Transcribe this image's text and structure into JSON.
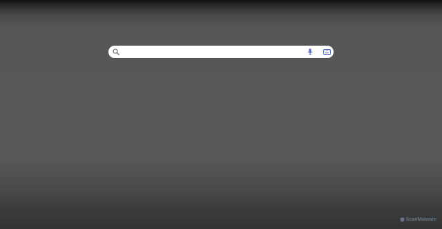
{
  "search": {
    "value": "",
    "placeholder": ""
  },
  "icons": {
    "search": "search-icon",
    "mic": "microphone-icon",
    "keyboard": "keyboard-icon"
  },
  "watermark": {
    "text": "ScanMalware"
  },
  "colors": {
    "accent": "#4a66c9",
    "searchbar_bg": "#ffffff",
    "background": "#575757"
  }
}
